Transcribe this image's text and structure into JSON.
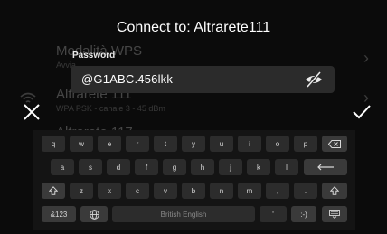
{
  "dialog": {
    "title": "Connect to: Altrarete111"
  },
  "password": {
    "label": "Password",
    "value": "@G1ABC.456lkk",
    "visibility_icon": "eye-off-icon"
  },
  "actions": {
    "close_icon": "close-icon",
    "confirm_icon": "checkmark-icon"
  },
  "background_list": [
    {
      "name": "Modalità WPS",
      "sub": "Avvia"
    },
    {
      "name": "Altrarete 111",
      "sub": "WPA PSK - canale 3 - 45 dBm"
    },
    {
      "name": "Altrarete 117",
      "sub": ""
    }
  ],
  "keyboard": {
    "row1": [
      "q",
      "w",
      "e",
      "r",
      "t",
      "y",
      "u",
      "i",
      "o",
      "p"
    ],
    "row2": [
      "a",
      "s",
      "d",
      "f",
      "g",
      "h",
      "j",
      "k",
      "l"
    ],
    "row3": [
      "z",
      "x",
      "c",
      "v",
      "b",
      "n",
      "m",
      ",",
      "."
    ],
    "symbols_key": "&123",
    "space_label": "British English",
    "apostrophe_key": "'",
    "emoticon_key": ":-)",
    "icons": [
      "backspace-icon",
      "enter-icon",
      "shift-icon",
      "globe-icon",
      "hide-keyboard-icon"
    ]
  }
}
